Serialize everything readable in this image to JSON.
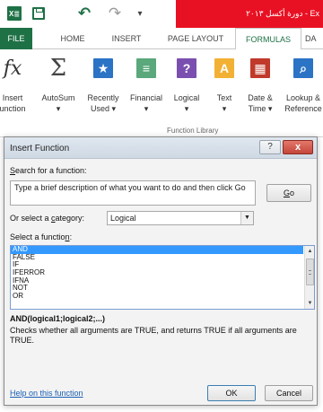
{
  "titlebar": {
    "app_icon_text": "X≣",
    "title": "دورة أكسل ٢٠١٣ - Ex",
    "accent": "#e81123"
  },
  "tabs": [
    {
      "label": "FILE"
    },
    {
      "label": "HOME"
    },
    {
      "label": "INSERT"
    },
    {
      "label": "PAGE LAYOUT"
    },
    {
      "label": "FORMULAS"
    },
    {
      "label": "DA"
    }
  ],
  "ribbon": {
    "buttons": [
      {
        "line1": "Insert",
        "line2": "unction",
        "icon": "fx-icon",
        "glyph": "fx"
      },
      {
        "line1": "AutoSum",
        "line2": "▾",
        "icon": "sigma-icon",
        "glyph": "Σ"
      },
      {
        "line1": "Recently",
        "line2": "Used ▾",
        "icon": "star-icon",
        "glyph": "★"
      },
      {
        "line1": "Financial",
        "line2": "▾",
        "icon": "financial-icon",
        "glyph": "≡"
      },
      {
        "line1": "Logical",
        "line2": "▾",
        "icon": "question-icon",
        "glyph": "?"
      },
      {
        "line1": "Text",
        "line2": "▾",
        "icon": "text-icon",
        "glyph": "A"
      },
      {
        "line1": "Date &",
        "line2": "Time ▾",
        "icon": "calendar-icon",
        "glyph": "▦"
      },
      {
        "line1": "Lookup &",
        "line2": "Reference",
        "icon": "lookup-icon",
        "glyph": "⌕"
      }
    ],
    "group_label": "Function Library"
  },
  "dialog": {
    "title": "Insert Function",
    "help_glyph": "?",
    "close_glyph": "x",
    "search_label_prefix": "",
    "search_label_u": "S",
    "search_label_rest": "earch for a function:",
    "search_value": "Type a brief description of what you want to do and then click Go",
    "go_u": "G",
    "go_rest": "o",
    "category_label_pre": "Or select a ",
    "category_label_u": "c",
    "category_label_rest": "ategory:",
    "category_value": "Logical",
    "function_label_pre": "Select a functio",
    "function_label_u": "n",
    "function_label_rest": ":",
    "functions": [
      "AND",
      "FALSE",
      "IF",
      "IFERROR",
      "IFNA",
      "NOT",
      "OR"
    ],
    "selected_function": "AND",
    "syntax": "AND(logical1;logical2;...)",
    "description": "Checks whether all arguments are TRUE, and returns TRUE if all arguments are TRUE.",
    "help_link": "Help on this function",
    "ok_label": "OK",
    "cancel_label": "Cancel"
  }
}
